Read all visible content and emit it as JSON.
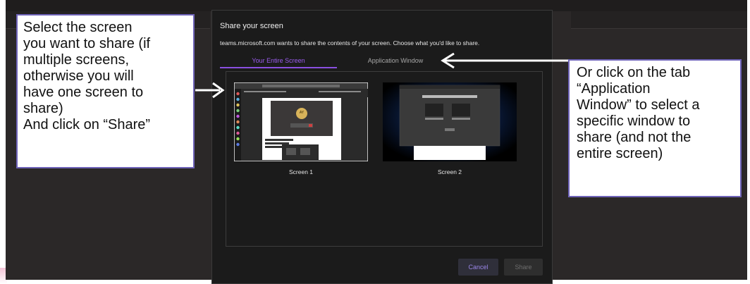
{
  "dialog": {
    "title": "Share your screen",
    "subtitle": "teams.microsoft.com wants to share the contents of your screen. Choose what you'd like to share.",
    "tabs": [
      {
        "label": "Your Entire Screen",
        "active": true
      },
      {
        "label": "Application Window",
        "active": false
      }
    ],
    "screens": [
      {
        "label": "Screen 1"
      },
      {
        "label": "Screen 2"
      }
    ],
    "cancel_label": "Cancel",
    "share_label": "Share",
    "thumb_badge": "AY"
  },
  "callouts": {
    "left": "Select the screen\nyou want to share (if\nmultiple screens,\notherwise you will\nhave one screen to\nshare)\nAnd click on “Share”",
    "right": "Or click on the tab\n“Application\nWindow” to select a\nspecific window to\nshare (and not the\nentire screen)"
  },
  "colors": {
    "accent": "#8a4fe0",
    "callout_border": "#6e63b8",
    "dialog_bg": "#1b1b1b",
    "app_bg": "#2b2828"
  }
}
